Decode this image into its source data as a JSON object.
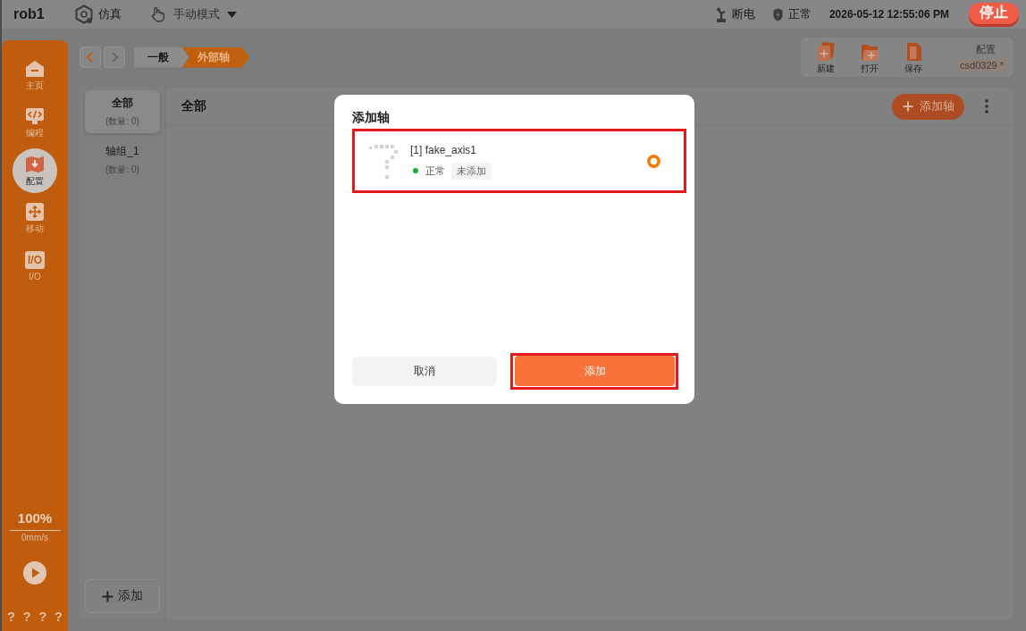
{
  "top_bar": {
    "robot_name": "rob1",
    "run_mode": "仿真",
    "operation_mode": "手动模式",
    "power_status": "断电",
    "safety_status": "正常",
    "datetime": "2026-05-12 12:55:06 PM",
    "stop_button": "停止"
  },
  "sidebar": {
    "items": [
      {
        "label": "主页",
        "selected": false
      },
      {
        "label": "编程",
        "selected": false
      },
      {
        "label": "配置",
        "selected": true
      },
      {
        "label": "移动",
        "selected": false
      },
      {
        "label": "I/O",
        "badge": "I/O",
        "selected": false
      }
    ],
    "speed_override": "100%",
    "speed": "0mm/s",
    "help_marks": [
      "?",
      "?",
      "?",
      "?"
    ]
  },
  "navigation": {
    "back": {
      "disabled": false
    },
    "forward": {
      "disabled": true
    }
  },
  "breadcrumb": [
    {
      "label": "一般",
      "selected": false
    },
    {
      "label": "外部轴",
      "selected": true
    }
  ],
  "toolbar": {
    "actions": [
      {
        "label": "新建"
      },
      {
        "label": "打开"
      },
      {
        "label": "保存"
      }
    ],
    "config_label": "配置",
    "config_value": "csd0329 *"
  },
  "groups": {
    "items": [
      {
        "name": "全部",
        "count": "(数量: 0)",
        "selected": true
      },
      {
        "name": "轴组_1",
        "count": "(数量: 0)",
        "selected": false
      }
    ],
    "add_button": "添加"
  },
  "main_panel": {
    "title": "全部",
    "add_axis_button": "添加轴"
  },
  "dialog": {
    "title": "添加轴",
    "axes": [
      {
        "name": "[1] fake_axis1",
        "status": "正常",
        "color": "#1aad3c",
        "tag": "未添加",
        "selected": true,
        "highlighted": true
      }
    ],
    "cancel_button": "取消",
    "confirm_button": "添加",
    "confirm_highlighted": true
  }
}
